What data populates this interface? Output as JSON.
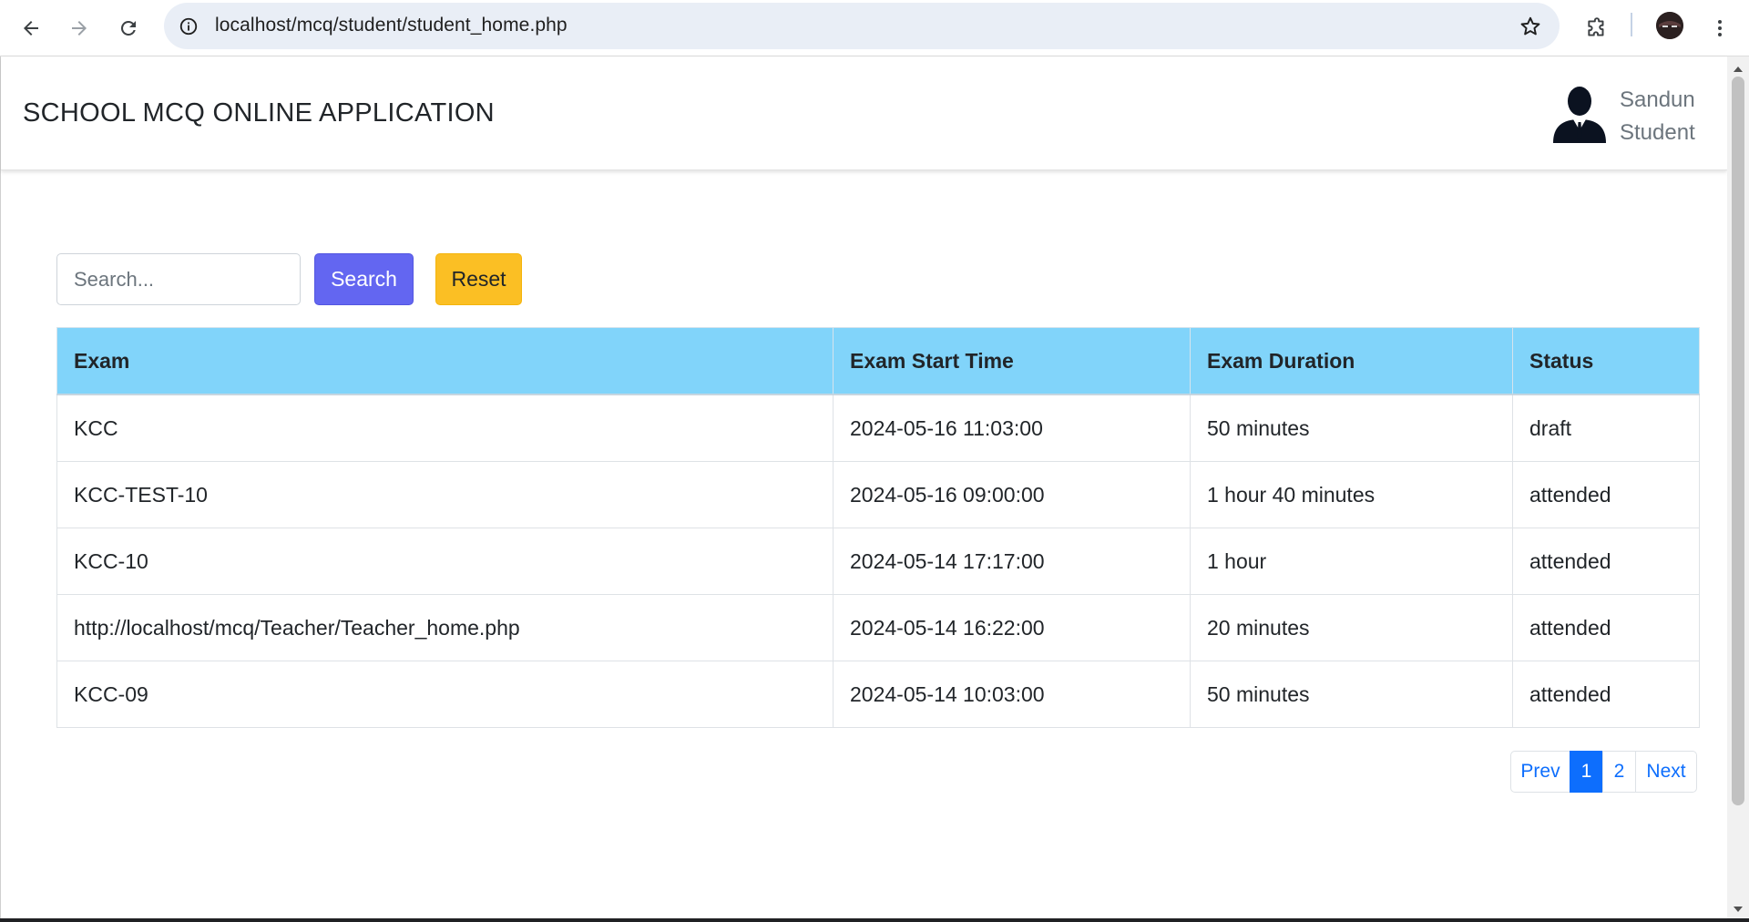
{
  "browser": {
    "url": "localhost/mcq/student/student_home.php"
  },
  "app": {
    "title": "SCHOOL MCQ ONLINE APPLICATION",
    "user_name": "Sandun",
    "user_role": "Student"
  },
  "search": {
    "placeholder": "Search...",
    "value": "",
    "search_label": "Search",
    "reset_label": "Reset"
  },
  "table": {
    "headers": [
      "Exam",
      "Exam Start Time",
      "Exam Duration",
      "Status"
    ],
    "rows": [
      [
        "KCC",
        "2024-05-16 11:03:00",
        "50 minutes",
        "draft"
      ],
      [
        "KCC-TEST-10",
        "2024-05-16 09:00:00",
        "1 hour 40 minutes",
        "attended"
      ],
      [
        "KCC-10",
        "2024-05-14 17:17:00",
        "1 hour",
        "attended"
      ],
      [
        "http://localhost/mcq/Teacher/Teacher_home.php",
        "2024-05-14 16:22:00",
        "20 minutes",
        "attended"
      ],
      [
        "KCC-09",
        "2024-05-14 10:03:00",
        "50 minutes",
        "attended"
      ]
    ]
  },
  "pagination": {
    "prev_label": "Prev",
    "pages": [
      "1",
      "2"
    ],
    "active_page": "1",
    "next_label": "Next"
  },
  "colors": {
    "table_header_bg": "#81d4fa",
    "search_button": "#6366f1",
    "reset_button": "#fbbf24",
    "active_page": "#0d6efd"
  }
}
